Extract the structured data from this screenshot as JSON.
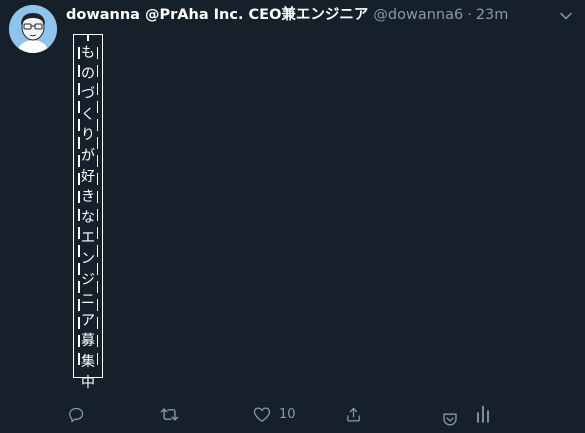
{
  "tweet": {
    "display_name": "dowanna @PrAha Inc. CEO兼エンジニア",
    "handle": "@dowanna6",
    "separator": "·",
    "time": "23m",
    "vertical_text": [
      "も",
      "の",
      "づ",
      "く",
      "り",
      "が",
      "好",
      "き",
      "な",
      "エ",
      "ン",
      "ジ",
      "ニ",
      "ア",
      "募",
      "集",
      "中"
    ]
  },
  "actions": {
    "reply": {
      "icon": "reply-icon"
    },
    "retweet": {
      "icon": "retweet-icon"
    },
    "like": {
      "icon": "heart-icon",
      "count": "10"
    },
    "share": {
      "icon": "share-icon"
    },
    "pocket": {
      "icon": "pocket-icon"
    },
    "analytics": {
      "icon": "analytics-icon"
    }
  },
  "colors": {
    "background": "#15202b",
    "secondary_text": "#8899a6",
    "avatar_bg": "#8fc5ec"
  }
}
